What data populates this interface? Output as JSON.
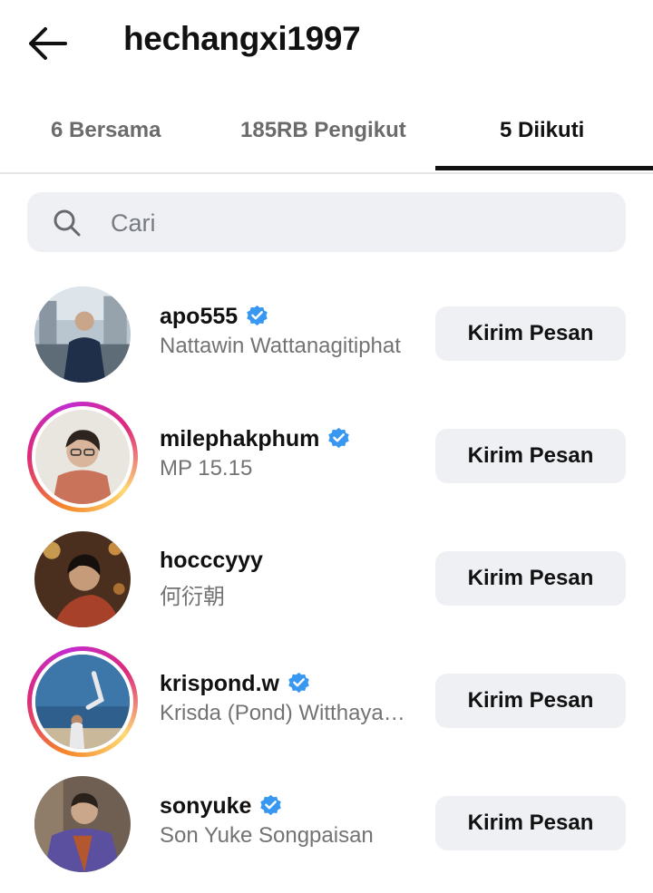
{
  "header": {
    "title": "hechangxi1997",
    "back_icon": "arrow-left-icon"
  },
  "tabs": [
    {
      "label": "6 Bersama",
      "active": false
    },
    {
      "label": "185RB Pengikut",
      "active": false
    },
    {
      "label": "5 Diikuti",
      "active": true
    }
  ],
  "search": {
    "placeholder": "Cari",
    "value": "",
    "icon": "search-icon"
  },
  "accounts": [
    {
      "username": "apo555",
      "verified": true,
      "full_name": "Nattawin Wattanagitiphat",
      "story_ring": false,
      "action_label": "Kirim Pesan"
    },
    {
      "username": "milephakphum",
      "verified": true,
      "full_name": "MP 15.15",
      "story_ring": true,
      "action_label": "Kirim Pesan"
    },
    {
      "username": "hocccyyy",
      "verified": false,
      "full_name": "何衍朝",
      "story_ring": false,
      "action_label": "Kirim Pesan"
    },
    {
      "username": "krispond.w",
      "verified": true,
      "full_name": "Krisda (Pond) Witthayakhajorndet",
      "story_ring": true,
      "action_label": "Kirim Pesan"
    },
    {
      "username": "sonyuke",
      "verified": true,
      "full_name": "Son Yuke Songpaisan",
      "story_ring": false,
      "action_label": "Kirim Pesan"
    }
  ],
  "colors": {
    "verified_badge": "#3897f0",
    "button_bg": "#eff0f3",
    "secondary_text": "#737373"
  }
}
